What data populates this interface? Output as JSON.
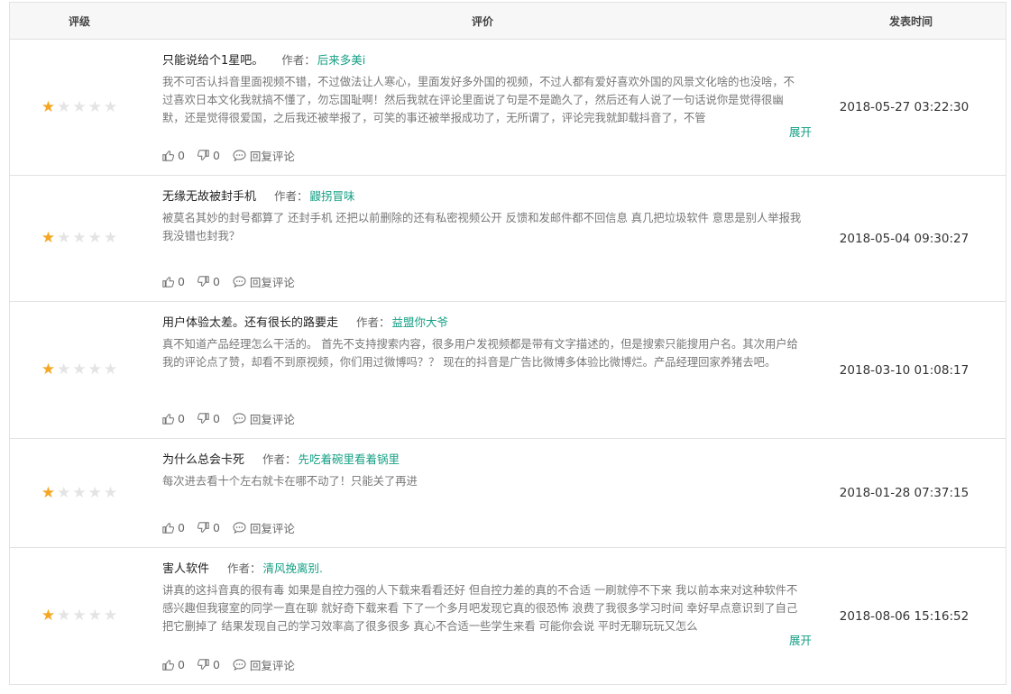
{
  "header": {
    "rating": "评级",
    "review": "评价",
    "time": "发表时间"
  },
  "labels": {
    "author": "作者：",
    "reply": "回复评论",
    "expand": "展开"
  },
  "colors": {
    "star_on": "#f5a623",
    "star_off": "#e4e4e4",
    "accent": "#16a085"
  },
  "reviews": [
    {
      "rating": 1,
      "title": "只能说给个1星吧。",
      "author": "后来多美i",
      "content": "我不可否认抖音里面视频不错，不过做法让人寒心，里面发好多外国的视频，不过人都有爱好喜欢外国的风景文化啥的也没啥，不过喜欢日本文化我就搞不懂了，勿忘国耻啊！然后我就在评论里面说了句是不是跪久了，然后还有人说了一句话说你是觉得很幽默，还是觉得很爱国，之后我还被举报了，可笑的事还被举报成功了，无所谓了，评论完我就卸载抖音了，不管",
      "likes": "0",
      "dislikes": "0",
      "time": "2018-05-27 03:22:30",
      "expandable": true
    },
    {
      "rating": 1,
      "title": "无缘无故被封手机",
      "author": "鼹拐冒味",
      "content": "被莫名其妙的封号都算了 还封手机 还把以前删除的还有私密视频公开 反馈和发邮件都不回信息 真几把垃圾软件 意思是别人举报我我没错也封我？",
      "likes": "0",
      "dislikes": "0",
      "time": "2018-05-04 09:30:27",
      "expandable": false
    },
    {
      "rating": 1,
      "title": "用户体验太差。还有很长的路要走",
      "author": "益盟你大爷",
      "content": "真不知道产品经理怎么干活的。 首先不支持搜索内容，很多用户发视频都是带有文字描述的，但是搜索只能搜用户名。其次用户给我的评论点了赞，却看不到原视频，你们用过微博吗？？ 现在的抖音是广告比微博多体验比微博烂。产品经理回家养猪去吧。",
      "likes": "0",
      "dislikes": "0",
      "time": "2018-03-10 01:08:17",
      "expandable": false
    },
    {
      "rating": 1,
      "title": "为什么总会卡死",
      "author": "先吃着碗里看着锅里",
      "content": "每次进去看十个左右就卡在哪不动了！只能关了再进",
      "likes": "0",
      "dislikes": "0",
      "time": "2018-01-28 07:37:15",
      "expandable": false
    },
    {
      "rating": 1,
      "title": "害人软件",
      "author": "清风挽离别.",
      "content": "讲真的这抖音真的很有毒 如果是自控力强的人下载来看看还好 但自控力差的真的不合适 一刷就停不下来 我以前本来对这种软件不感兴趣但我寝室的同学一直在聊 就好奇下载来看 下了一个多月吧发现它真的很恐怖 浪费了我很多学习时间 幸好早点意识到了自己把它删掉了 结果发现自己的学习效率高了很多很多 真心不合适一些学生来看 可能你会说 平时无聊玩玩又怎么",
      "likes": "0",
      "dislikes": "0",
      "time": "2018-08-06 15:16:52",
      "expandable": true
    }
  ]
}
